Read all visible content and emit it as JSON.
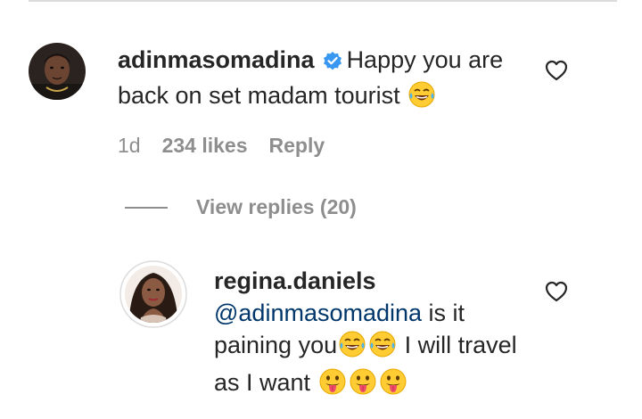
{
  "comments": [
    {
      "username": "adinmasomadina",
      "verified": true,
      "text": "Happy you are back on set madam tourist",
      "emoji": "laughing-tears",
      "timestamp": "1d",
      "likes": "234 likes",
      "reply_label": "Reply"
    },
    {
      "username": "regina.daniels",
      "mention": "@adinmasomadina",
      "text_part1": " is it paining you",
      "text_part2": " I will travel as I want",
      "emojis": [
        "laughing-tears",
        "laughing-tears",
        "tongue-out",
        "tongue-out",
        "tongue-out"
      ]
    }
  ],
  "view_replies_label": "View replies (20)",
  "colors": {
    "text": "#262626",
    "meta": "#8e8e8e",
    "mention": "#00376b",
    "verified": "#3897f0"
  },
  "icons": {
    "like": "heart-outline-icon",
    "verified": "verified-badge-icon"
  }
}
